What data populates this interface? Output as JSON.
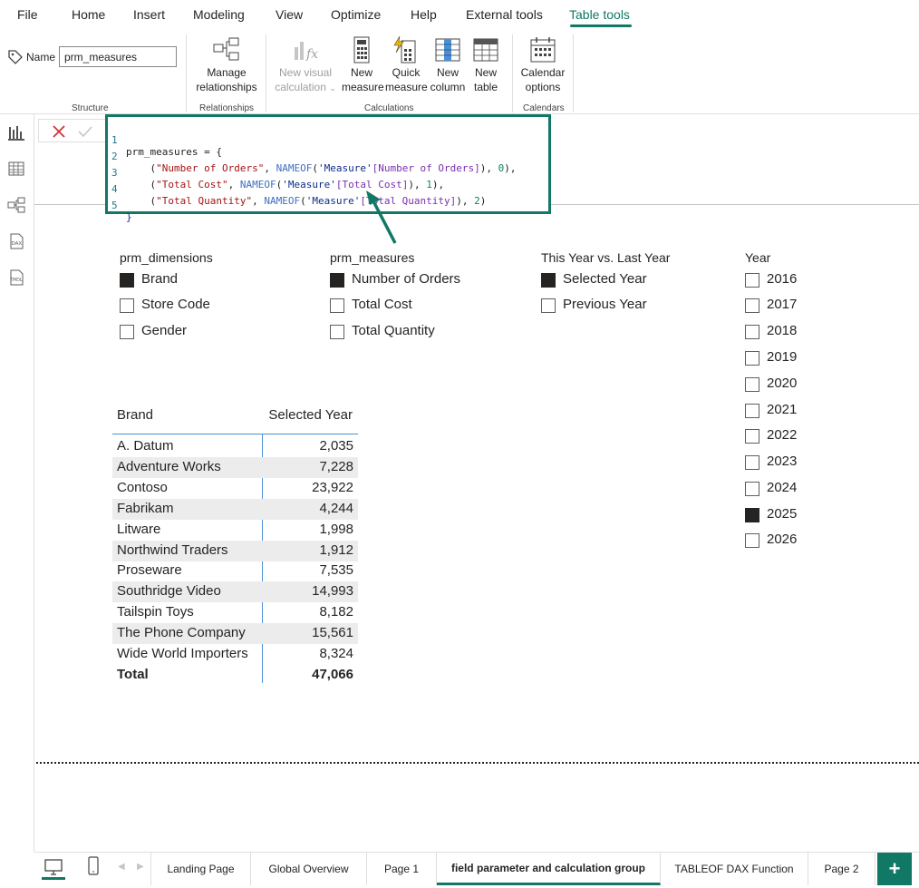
{
  "menu": {
    "file": "File",
    "home": "Home",
    "insert": "Insert",
    "modeling": "Modeling",
    "view": "View",
    "optimize": "Optimize",
    "help": "Help",
    "external_tools": "External tools",
    "table_tools": "Table tools"
  },
  "ribbon": {
    "name_label": "Name",
    "name_value": "prm_measures",
    "groups": {
      "structure": "Structure",
      "relationships": "Relationships",
      "calculations": "Calculations",
      "calendars": "Calendars"
    },
    "manage_relationships": [
      "Manage",
      "relationships"
    ],
    "new_visual_calculation": [
      "New visual",
      "calculation"
    ],
    "new_measure": [
      "New",
      "measure"
    ],
    "quick_measure": [
      "Quick",
      "measure"
    ],
    "new_column": [
      "New",
      "column"
    ],
    "new_table": [
      "New",
      "table"
    ],
    "calendar_options": [
      "Calendar",
      "options"
    ]
  },
  "formula": {
    "line_numbers": [
      "1",
      "2",
      "3",
      "4",
      "5"
    ],
    "line1": "prm_measures = {",
    "line2": {
      "indent": "    (",
      "str": "\"Number of Orders\"",
      "sep": ", ",
      "fn": "NAMEOF",
      "p1": "(",
      "tbl": "'Measure'",
      "col": "[Number of Orders]",
      "p2": "), ",
      "num": "0",
      "end": "),"
    },
    "line3": {
      "indent": "    (",
      "str": "\"Total Cost\"",
      "sep": ", ",
      "fn": "NAMEOF",
      "p1": "(",
      "tbl": "'Measure'",
      "col": "[Total Cost]",
      "p2": "), ",
      "num": "1",
      "end": "),"
    },
    "line4": {
      "indent": "    (",
      "str": "\"Total Quantity\"",
      "sep": ", ",
      "fn": "NAMEOF",
      "p1": "(",
      "tbl": "'Measure'",
      "col": "[Total Quantity]",
      "p2": "), ",
      "num": "2",
      "end": ")"
    },
    "line5": "}"
  },
  "slicers": {
    "dimensions": {
      "title": "prm_dimensions",
      "items": [
        "Brand",
        "Store Code",
        "Gender"
      ],
      "checked": [
        true,
        false,
        false
      ]
    },
    "measures": {
      "title": "prm_measures",
      "items": [
        "Number of Orders",
        "Total Cost",
        "Total Quantity"
      ],
      "checked": [
        true,
        false,
        false
      ]
    },
    "year_compare": {
      "title": "This Year vs. Last Year",
      "items": [
        "Selected Year",
        "Previous Year"
      ],
      "checked": [
        true,
        false
      ]
    },
    "year": {
      "title": "Year",
      "items": [
        "2016",
        "2017",
        "2018",
        "2019",
        "2020",
        "2021",
        "2022",
        "2023",
        "2024",
        "2025",
        "2026"
      ],
      "checked": [
        false,
        false,
        false,
        false,
        false,
        false,
        false,
        false,
        false,
        true,
        false
      ]
    }
  },
  "table": {
    "headers": [
      "Brand",
      "Selected Year"
    ],
    "rows": [
      [
        "A. Datum",
        "2,035"
      ],
      [
        "Adventure Works",
        "7,228"
      ],
      [
        "Contoso",
        "23,922"
      ],
      [
        "Fabrikam",
        "4,244"
      ],
      [
        "Litware",
        "1,998"
      ],
      [
        "Northwind Traders",
        "1,912"
      ],
      [
        "Proseware",
        "7,535"
      ],
      [
        "Southridge Video",
        "14,993"
      ],
      [
        "Tailspin Toys",
        "8,182"
      ],
      [
        "The Phone Company",
        "15,561"
      ],
      [
        "Wide World Importers",
        "8,324"
      ]
    ],
    "total": [
      "Total",
      "47,066"
    ]
  },
  "tabs": [
    "Landing Page",
    "Global Overview",
    "Page 1",
    "field parameter and calculation group",
    "TABLEOF DAX Function",
    "Page 2"
  ],
  "active_tab_index": 3,
  "add_page": "+",
  "colors": {
    "accent": "#117865",
    "checked": "#252423"
  }
}
